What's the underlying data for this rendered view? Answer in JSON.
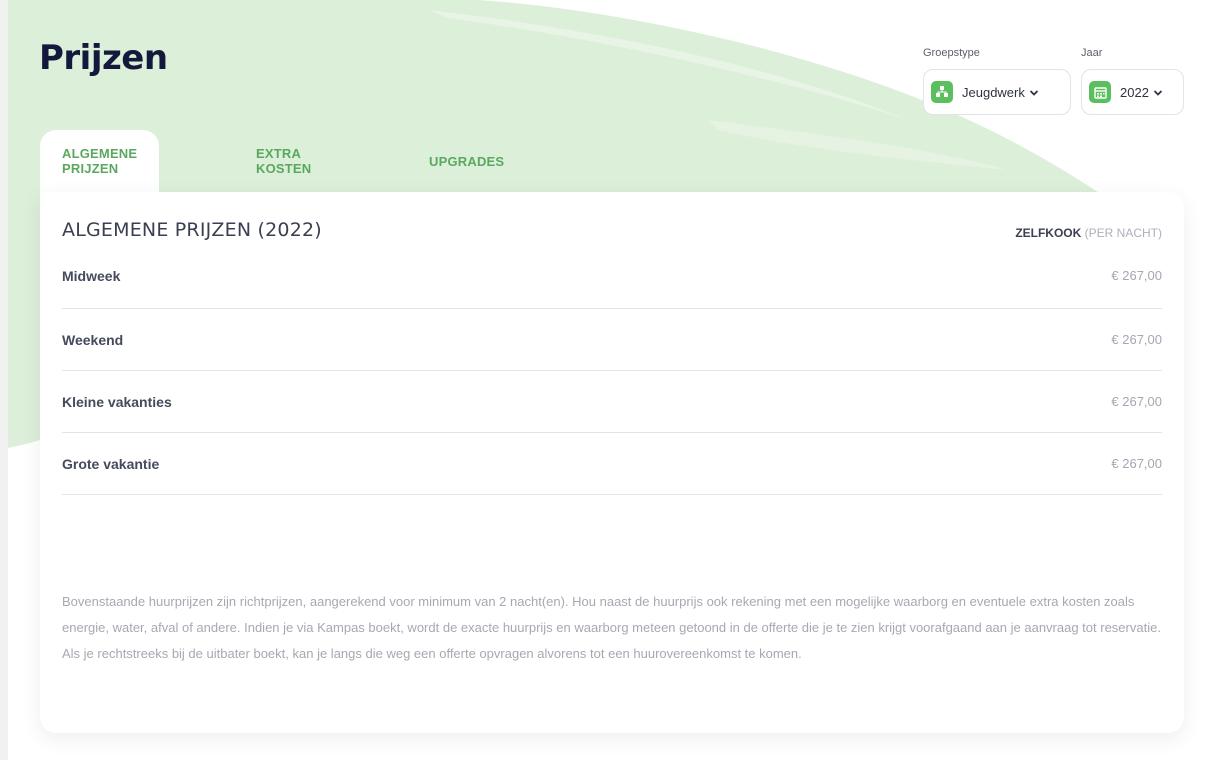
{
  "page": {
    "title": "Prijzen"
  },
  "filters": {
    "group_type": {
      "label": "Groepstype",
      "value": "Jeugdwerk",
      "icon": "group-icon"
    },
    "year": {
      "label": "Jaar",
      "value": "2022",
      "icon": "calendar-icon"
    }
  },
  "tabs": [
    {
      "label": "ALGEMENE PRIJZEN",
      "active": true
    },
    {
      "label": "EXTRA KOSTEN",
      "active": false
    },
    {
      "label": "UPGRADES",
      "active": false
    }
  ],
  "prices": {
    "title": "ALGEMENE PRIJZEN (2022)",
    "column_head": "ZELFKOOK",
    "column_sub": "(PER NACHT)",
    "rows": [
      {
        "label": "Midweek",
        "price": "€ 267,00"
      },
      {
        "label": "Weekend",
        "price": "€ 267,00"
      },
      {
        "label": "Kleine vakanties",
        "price": "€ 267,00"
      },
      {
        "label": "Grote vakantie",
        "price": "€ 267,00"
      }
    ],
    "disclaimer": "Bovenstaande huurprijzen zijn richtprijzen, aangerekend voor minimum van 2 nacht(en). Hou naast de huurprijs ook rekening met een mogelijke waarborg en eventuele extra kosten zoals energie, water, afval of andere. Indien je via Kampas boekt, wordt de exacte huurprijs en waarborg meteen getoond in de offerte die je te zien krijgt voorafgaand aan je aanvraag tot reservatie. Als je rechtstreeks bij de uitbater boekt, kan je langs die weg een offerte opvragen alvorens tot een huurovereenkomst te komen."
  },
  "colors": {
    "accent": "#5cbf5e",
    "brush": "#dcefd8",
    "title": "#14183c"
  }
}
